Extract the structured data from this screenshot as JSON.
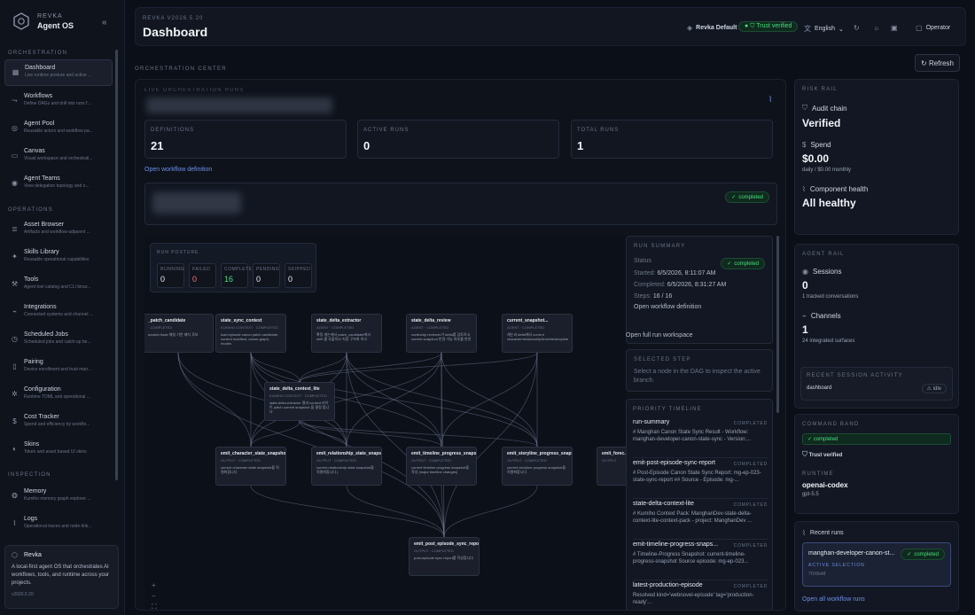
{
  "sidebar": {
    "brand": "REVKA",
    "product": "Agent OS",
    "collapse": "«",
    "sections": [
      "ORCHESTRATION",
      "OPERATIONS",
      "INSPECTION"
    ],
    "items": [
      {
        "label": "Dashboard",
        "sub": "Live runtime posture and active ...",
        "icon": "grid-icon",
        "glyph": "▦"
      },
      {
        "label": "Workflows",
        "sub": "Define DAGs and drill into runs f...",
        "icon": "workflow-icon",
        "glyph": "⤳"
      },
      {
        "label": "Agent Pool",
        "sub": "Reusable actors and workflow pa...",
        "icon": "agents-icon",
        "glyph": "◎"
      },
      {
        "label": "Canvas",
        "sub": "Visual workspace and orchestrati...",
        "icon": "monitor-icon",
        "glyph": "▭"
      },
      {
        "label": "Agent Teams",
        "sub": "View delegation topology and o...",
        "icon": "team-icon",
        "glyph": "◉"
      },
      {
        "label": "Asset Browser",
        "sub": "Artifacts and workflow-adjacent ...",
        "icon": "database-icon",
        "glyph": "≣"
      },
      {
        "label": "Skills Library",
        "sub": "Reusable operational capabilities",
        "icon": "sparkle-icon",
        "glyph": "✦"
      },
      {
        "label": "Tools",
        "sub": "Agent tool catalog and CLI binar...",
        "icon": "wrench-icon",
        "glyph": "⚒"
      },
      {
        "label": "Integrations",
        "sub": "Connected systems and channel ...",
        "icon": "plug-icon",
        "glyph": "⌁"
      },
      {
        "label": "Scheduled Jobs",
        "sub": "Scheduled jobs and catch-up be...",
        "icon": "clock-icon",
        "glyph": "◷"
      },
      {
        "label": "Pairing",
        "sub": "Device enrollment and trust man...",
        "icon": "phone-icon",
        "glyph": "▯"
      },
      {
        "label": "Configuration",
        "sub": "Runtime TOML and operational ...",
        "icon": "gear-icon",
        "glyph": "✲"
      },
      {
        "label": "Cost Tracker",
        "sub": "Spend and efficiency by workflo...",
        "icon": "dollar-icon",
        "glyph": "$"
      },
      {
        "label": "Skins",
        "sub": "Token and asset based UI skins",
        "icon": "palette-icon",
        "glyph": "◐"
      },
      {
        "label": "Memory",
        "sub": "Kumiho memory graph explorer ...",
        "icon": "brain-icon",
        "glyph": "❂"
      },
      {
        "label": "Logs",
        "sub": "Operational traces and node-link...",
        "icon": "pulse-icon",
        "glyph": "⌇"
      }
    ],
    "card": {
      "title": "Revka",
      "desc": "A local-first agent OS that orchestrates AI workflows, tools, and runtime across your projects.",
      "version": "v2026.5.20"
    }
  },
  "topbar": {
    "version": "REVKA V2026.5.20",
    "title": "Dashboard",
    "skin": "Revka Default",
    "trust": "Trust verified",
    "lang": "English",
    "user": "Operator"
  },
  "orch": {
    "label": "ORCHESTRATION CENTER",
    "refresh": "Refresh",
    "live_label": "LIVE ORCHESTRATION RUNS",
    "stats": [
      {
        "label": "DEFINITIONS",
        "value": "21"
      },
      {
        "label": "ACTIVE RUNS",
        "value": "0"
      },
      {
        "label": "TOTAL RUNS",
        "value": "1"
      }
    ],
    "open_def": "Open workflow definition",
    "status": "completed"
  },
  "posture": {
    "label": "RUN POSTURE",
    "cells": [
      {
        "k": "RUNNING",
        "v": "0",
        "c": "#e6e9f0"
      },
      {
        "k": "FAILED",
        "v": "0",
        "c": "#f87171"
      },
      {
        "k": "COMPLETE",
        "v": "16",
        "c": "#4ade80"
      },
      {
        "k": "PENDING",
        "v": "0",
        "c": "#e6e9f0"
      },
      {
        "k": "SKIPPED",
        "v": "0",
        "c": "#e6e9f0"
      }
    ]
  },
  "dag_nodes": [
    {
      "t": "_patch_candidate",
      "m": "· COMPLETED",
      "d": "scratch base 매칭 기반 패치 후보"
    },
    {
      "t": "state_sync_context",
      "m": "KUMIHO CONTEXT · COMPLETED",
      "d": "load episode canon patch candidate, context manifest, canon-graph, modes"
    },
    {
      "t": "state_delta_extractor",
      "m": "AGENT · COMPLETED",
      "d": "확정 캐논에서 patch_candidate에서 shift 를 추출하고 지정 구조화 하고"
    },
    {
      "t": "state_delta_review",
      "m": "AGENT · COMPLETED",
      "d": "continuity-reviewer가 delta를 검토하고 current snapshot 반영 가능 여부를 판정"
    },
    {
      "t": "current_snapshot...",
      "m": "AGENT · COMPLETED",
      "d": "캐논과 delta에서 current character/relationship/timeline/storyline"
    },
    {
      "t": "state_delta_context_lite",
      "m": "KUMIHO CONTEXT · COMPLETED",
      "d": "state-delta-extractor 결과 context 라이트 patch current snapshot 을 결정 합니다"
    },
    {
      "t": "emit_character_state_snapshot",
      "m": "OUTPUT · COMPLETED",
      "d": "current character state snapshot을 직렬화합니다"
    },
    {
      "t": "emit_relationship_state_snapshot",
      "m": "OUTPUT · COMPLETED",
      "d": "current relationship state snapshot을 직렬화합니다 ("
    },
    {
      "t": "emit_timeline_progress_snapshot",
      "m": "OUTPUT · COMPLETED",
      "d": "current timeline progress snapshot을 작성 (major timeline changes)"
    },
    {
      "t": "emit_storyline_progress_snapshot",
      "m": "OUTPUT · COMPLETED",
      "d": "current storyline progress snapshot을 직렬화합니다"
    },
    {
      "t": "emit_forec...",
      "m": "OUTPUT",
      "d": ""
    },
    {
      "t": "emit_post_episode_sync_report",
      "m": "OUTPUT · COMPLETED",
      "d": "post-episode sync report를 작성합니다"
    }
  ],
  "zoom": [
    "+",
    "−",
    "⛶"
  ],
  "run_summary": {
    "label": "RUN SUMMARY",
    "status_k": "Status",
    "status": "completed",
    "started_k": "Started:",
    "started": "6/5/2026, 8:11:07 AM",
    "completed_k": "Completed:",
    "completed": "6/5/2026, 8:31:27 AM",
    "steps_k": "Steps:",
    "steps": "16 / 16",
    "open_def": "Open workflow definition",
    "open_full": "Open full run workspace"
  },
  "selected_step": {
    "label": "SELECTED STEP",
    "text": "Select a node in the DAG to inspect the active branch."
  },
  "timeline": {
    "label": "PRIORITY TIMELINE",
    "items": [
      {
        "t": "run-summary",
        "s": "COMPLETED",
        "d": "# Manghan Canon State Sync Result - Workflow: manghan-developer-canon-state-sync - Version:..."
      },
      {
        "t": "emit-post-episode-sync-report",
        "s": "COMPLETED",
        "d": "# Post-Episode Canon State Sync Report: mg-ep-023-state-sync-report ## Source - Episode: mg-..."
      },
      {
        "t": "state-delta-context-lite",
        "s": "COMPLETED",
        "d": "# Kumiho Context Pack: ManghanDev-state-delta-context-lite-context-pack - project: ManghanDev ..."
      },
      {
        "t": "emit-timeline-progress-snaps...",
        "s": "COMPLETED",
        "d": "# Timeline-Progress Snapshot: current-timeline-progress-snapshot Source episode: mg-ep-023..."
      },
      {
        "t": "latest-production-episode",
        "s": "COMPLETED",
        "d": "Resolved kind='webnovel-episode' tag='production-ready'..."
      }
    ]
  },
  "risk": {
    "label": "RISK RAIL",
    "audit_k": "Audit chain",
    "audit_v": "Verified",
    "spend_k": "Spend",
    "spend_v": "$0.00",
    "spend_s": "daily / $0.00 monthly",
    "health_k": "Component health",
    "health_v": "All healthy"
  },
  "agent": {
    "label": "AGENT RAIL",
    "sessions_k": "Sessions",
    "sessions_v": "0",
    "sessions_s": "1 tracked conversations",
    "channels_k": "Channels",
    "channels_v": "1",
    "channels_s": "24 integrated surfaces",
    "recent_label": "RECENT SESSION ACTIVITY",
    "recent_name": "dashboard",
    "recent_state": "idle"
  },
  "command": {
    "label": "COMMAND BAND",
    "status": "completed",
    "trust": "Trust verified",
    "runtime_label": "RUNTIME",
    "runtime": "openai-codex",
    "model": "gpt-5.5"
  },
  "recent_runs": {
    "label": "Recent runs",
    "name": "manghan-developer-canon-st...",
    "status": "completed",
    "sel": "ACTIVE SELECTION",
    "id": "7f1f6b48",
    "open_all": "Open all workflow runs"
  },
  "colors": {
    "accent": "#6f8fe8",
    "success": "#4ade80",
    "danger": "#f87171"
  }
}
